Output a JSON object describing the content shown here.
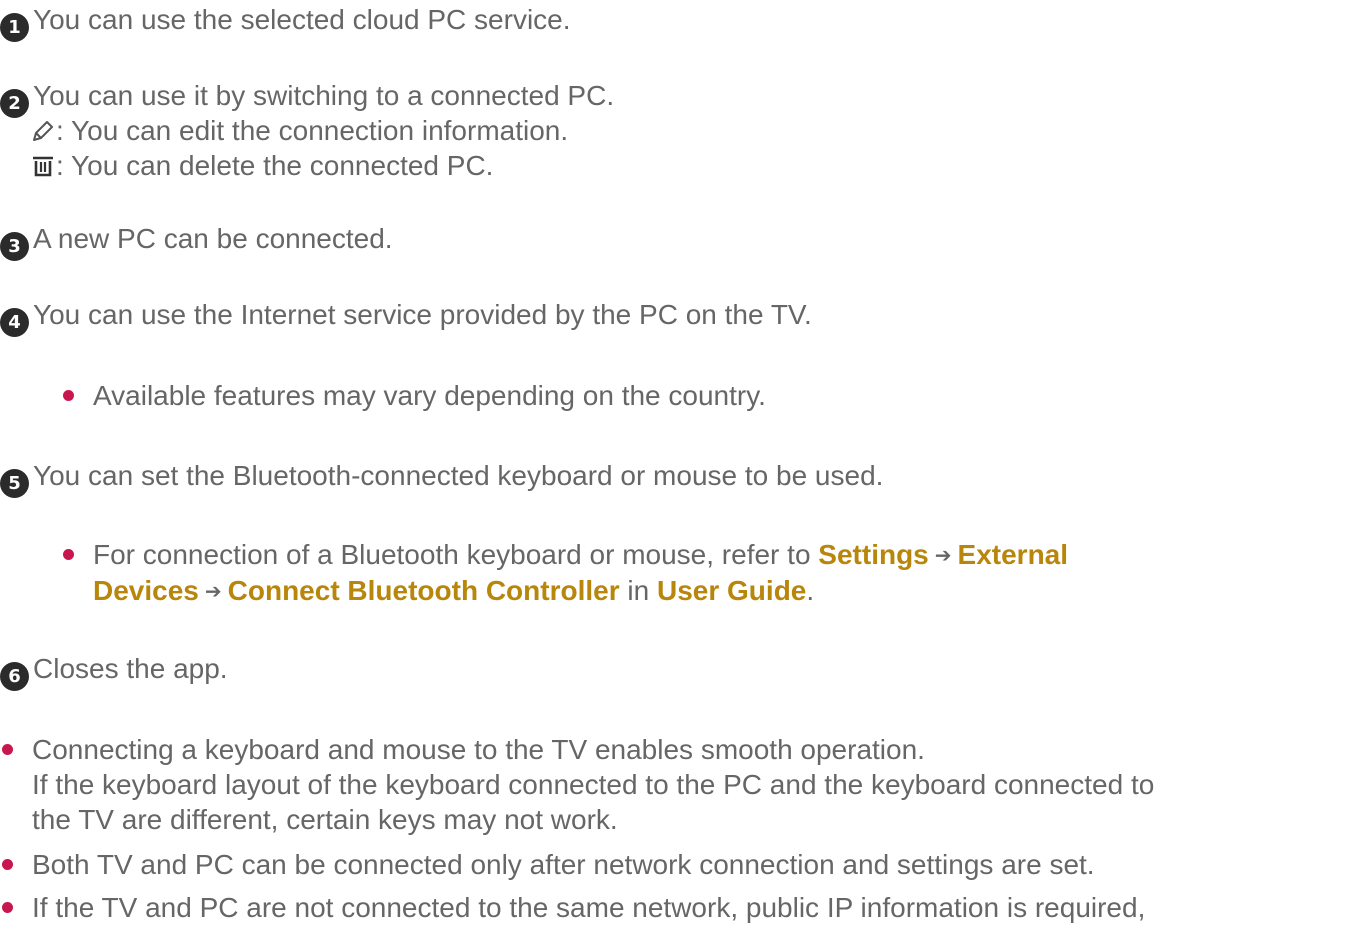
{
  "items": [
    {
      "num": "1",
      "text": "You can use the selected cloud PC service."
    },
    {
      "num": "2",
      "text": "You can use it by switching to a connected PC.",
      "sub": [
        {
          "icon": "pencil-icon",
          "text": ": You can edit the connection information."
        },
        {
          "icon": "trash-icon",
          "text": ": You can delete the connected PC."
        }
      ]
    },
    {
      "num": "3",
      "text": "A new PC can be connected."
    },
    {
      "num": "4",
      "text": "You can use the Internet service provided by the PC on the TV.",
      "bullet": "Available features may vary depending on the country."
    },
    {
      "num": "5",
      "text": "You can set the Bluetooth-connected keyboard or mouse to be used.",
      "bullet": {
        "prefix": "For connection of a Bluetooth keyboard or mouse, refer to",
        "link1": "Settings",
        "link2": "External",
        "link3": "Devices",
        "link4": "Connect Bluetooth Controller",
        "mid": "in",
        "link5": "User Guide",
        "suffix": "."
      }
    },
    {
      "num": "6",
      "text": "Closes the app."
    }
  ],
  "notes": [
    {
      "line1": "Connecting a keyboard and mouse to the TV enables smooth operation.",
      "line2": "If the keyboard layout of the keyboard connected to the PC and the keyboard connected to",
      "line3": "the TV are different, certain keys may not work."
    },
    {
      "line1": "Both TV and PC can be connected only after network connection and settings are set."
    },
    {
      "line1": "If the TV and PC are not connected to the same network, public IP information is required,"
    }
  ],
  "colors": {
    "text": "#666666",
    "highlight": "#b8860b",
    "bullet": "#c8174f",
    "badge": "#2b2b2b"
  }
}
